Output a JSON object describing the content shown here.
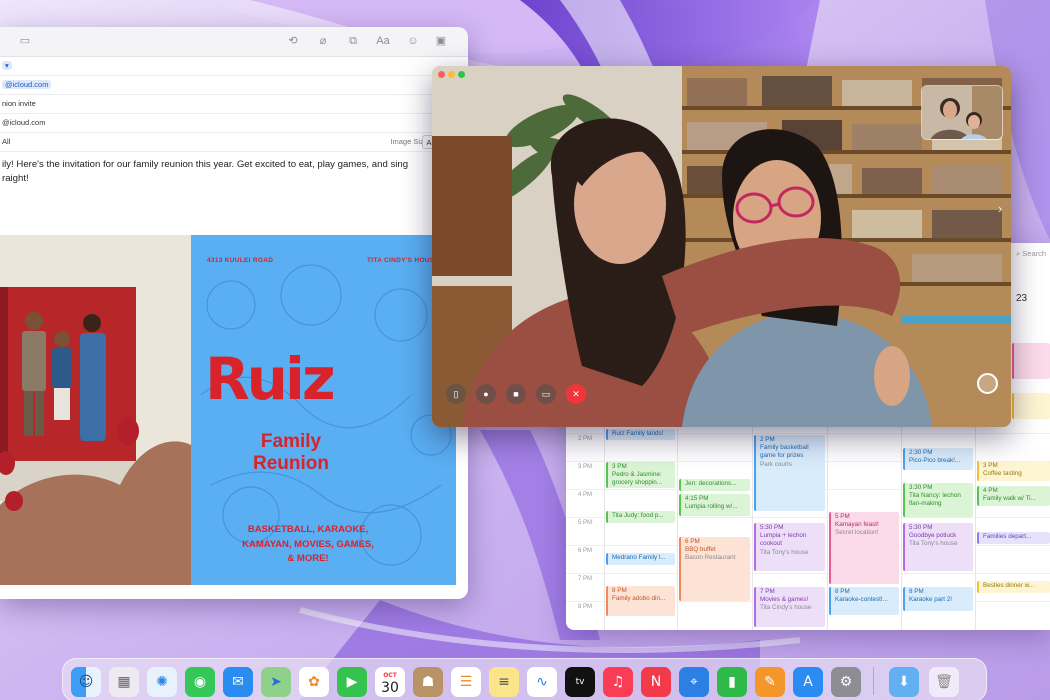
{
  "mail": {
    "from_pill": "",
    "to_address": "@icloud.com",
    "subject": "nion invite",
    "cc_address": "@icloud.com",
    "field_label": "All",
    "image_size_label": "Image Size:",
    "image_size_value": "Actual Size",
    "body_line1": "ily! Here's the invitation for our family reunion this year. Get excited to eat, play games, and sing",
    "body_line2": "raight!",
    "poster": {
      "address": "4313 KUULEI ROAD",
      "host": "TITA CINDY'S HOUSE",
      "title": "Ruiz",
      "subtitle_line1": "Family",
      "subtitle_line2": "Reunion",
      "activities_line1": "BASKETBALL, KARAOKE,",
      "activities_line2": "KAMAYAN, MOVIES, GAMES,",
      "activities_line3": "& MORE!"
    }
  },
  "calendar": {
    "search_label": "Search",
    "date_label": "23",
    "time_labels": [
      "2 PM",
      "3 PM",
      "4 PM",
      "5 PM",
      "6 PM",
      "7 PM",
      "8 PM"
    ],
    "events": {
      "e1": {
        "title": "Ruiz Family lands!"
      },
      "e2": {
        "time": "2 PM",
        "title": "Family basketball",
        "title2": "game for prizes",
        "sub": "Park courts"
      },
      "e3": {
        "time": "2:30 PM",
        "title": "Pico-Pico break!..."
      },
      "e4": {
        "time": "3 PM",
        "title": "Coffee tasting"
      },
      "e5": {
        "time": "3 PM",
        "title": "Pedro & Jasmine:",
        "title2": "grocery shoppin..."
      },
      "e6": {
        "title": "Jen: decorations..."
      },
      "e7": {
        "time": "3:30 PM",
        "title": "Tita Nancy: lechon",
        "title2": "flan-making"
      },
      "e8": {
        "time": "4 PM",
        "title": "Family walk w/ Ti..."
      },
      "e9": {
        "time": "4:15 PM",
        "title": "Lumpia rolling w/..."
      },
      "e10": {
        "title": "Tita Judy: food p..."
      },
      "e11": {
        "time": "5 PM",
        "title": "Kamayan feast!",
        "sub": "Secret location!"
      },
      "e12": {
        "time": "5:30 PM",
        "title": "Lumpia + lechon",
        "title2": "cookout",
        "sub": "Tita Tony's house"
      },
      "e13": {
        "time": "5:30 PM",
        "title": "Goodbye potluck",
        "sub": "Tita Tony's house"
      },
      "e14": {
        "title": "Families depart..."
      },
      "e15": {
        "time": "6 PM",
        "title": "BBQ buffet",
        "sub": "Bacon Restaurant"
      },
      "e16": {
        "title": "Medrano Family l..."
      },
      "e17": {
        "time": "7 PM",
        "title": "Movies & games!",
        "sub": "Tita Cindy's house"
      },
      "e18": {
        "title": "Besties dinner w..."
      },
      "e19": {
        "time": "8 PM",
        "title": "Family adobo din..."
      },
      "e20": {
        "time": "8 PM",
        "title": "Karaoke-contest!..."
      },
      "e21": {
        "time": "8 PM",
        "title": "Karaoke part 2!"
      }
    }
  },
  "dock": {
    "calendar_month": "OCT",
    "calendar_day": "30",
    "apps": [
      "Finder",
      "Launchpad",
      "Safari",
      "Messages",
      "Mail",
      "Maps",
      "Photos",
      "FaceTime",
      "Calendar",
      "Contacts",
      "Reminders",
      "Notes",
      "Freeform",
      "TV",
      "Music",
      "News",
      "Keynote",
      "Numbers",
      "Pages",
      "App Store",
      "System Settings",
      "Downloads",
      "Trash"
    ]
  },
  "colors": {
    "poster_blue": "#5aaef2",
    "poster_red": "#d8232a",
    "end_call_red": "#f2343b"
  }
}
